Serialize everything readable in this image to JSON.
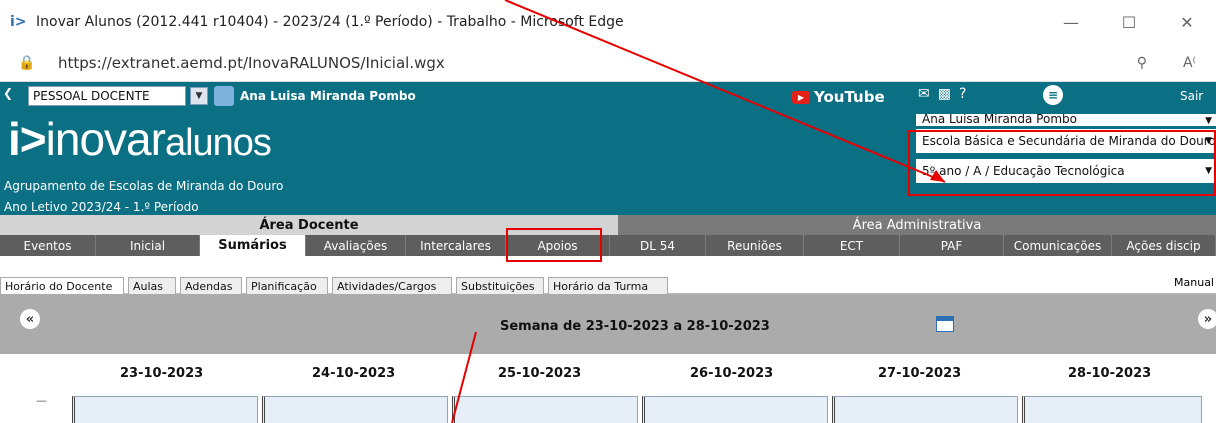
{
  "window": {
    "title": "Inovar Alunos (2012.441 r10404) - 2023/24 (1.º Período) - Trabalho - Microsoft Edge",
    "min": "—",
    "max": "☐",
    "close": "✕"
  },
  "address": {
    "url": "https://extranet.aemd.pt/InovaRALUNOS/Inicial.wgx"
  },
  "header": {
    "role_select": "PESSOAL DOCENTE",
    "user_name": "Ana Luisa Miranda Pombo",
    "brand_light": "inovar",
    "brand_bold": "alunos",
    "agrupamento": "Agrupamento de Escolas de Miranda do Douro",
    "ano_letivo": "Ano Letivo 2023/24 - 1.º Período",
    "youtube": "YouTube",
    "sair": "Sair",
    "select_user": "Ana Luisa Miranda Pombo",
    "select_school": "Escola Básica e Secundária de Miranda do Douro",
    "select_class": "5º ano / A / Educação Tecnológica"
  },
  "areas": {
    "docente": "Área Docente",
    "administrativa": "Área Administrativa"
  },
  "nav": [
    {
      "label": "Eventos"
    },
    {
      "label": "Inicial"
    },
    {
      "label": "Sumários"
    },
    {
      "label": "Avaliações"
    },
    {
      "label": "Intercalares"
    },
    {
      "label": "Apoios"
    },
    {
      "label": "DL 54"
    },
    {
      "label": "Reuniões"
    },
    {
      "label": "ECT"
    },
    {
      "label": "PAF"
    },
    {
      "label": "Comunicações"
    },
    {
      "label": "Ações discip"
    }
  ],
  "subtabs": [
    {
      "label": "Horário do Docente"
    },
    {
      "label": "Aulas"
    },
    {
      "label": "Adendas"
    },
    {
      "label": "Planificação"
    },
    {
      "label": "Atividades/Cargos"
    },
    {
      "label": "Substituições"
    },
    {
      "label": "Horário da Turma"
    }
  ],
  "manual": "Manual",
  "week": {
    "title": "Semana de 23-10-2023 a 28-10-2023",
    "prev": "«",
    "next": "»"
  },
  "days": [
    "23-10-2023",
    "24-10-2023",
    "25-10-2023",
    "26-10-2023",
    "27-10-2023",
    "28-10-2023"
  ],
  "colors": {
    "header": "#0c7085",
    "nav": "#5e5e5e",
    "annotation": "#e60000"
  }
}
